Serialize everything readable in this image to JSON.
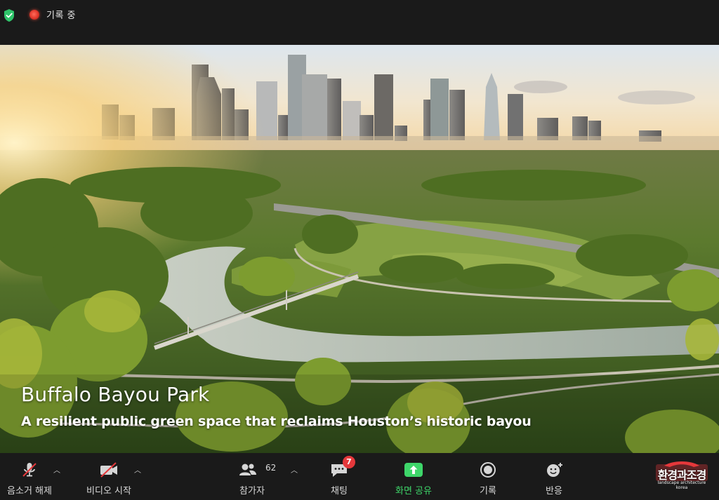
{
  "top_bar": {
    "recording_label": "기록 중",
    "colors": {
      "shield": "#2fc46a",
      "recording": "#e0362a"
    }
  },
  "slide": {
    "title": "Buffalo Bayou Park",
    "subtitle": "A resilient public green space that reclaims Houston’s historic bayou"
  },
  "toolbar": {
    "mute": {
      "label": "음소거 해제",
      "icon": "microphone-muted-icon"
    },
    "video": {
      "label": "비디오 시작",
      "icon": "video-off-icon"
    },
    "participants": {
      "label": "참가자",
      "count": "62",
      "icon": "participants-icon"
    },
    "chat": {
      "label": "채팅",
      "badge": "7",
      "icon": "chat-icon"
    },
    "share": {
      "label": "화면 공유",
      "icon": "share-screen-icon",
      "color": "#3ed66a"
    },
    "record": {
      "label": "기록",
      "icon": "record-icon"
    },
    "reactions": {
      "label": "반응",
      "icon": "reaction-icon"
    }
  },
  "logo": {
    "text": "환경과조경",
    "subtext": "landscape architecture korea"
  }
}
